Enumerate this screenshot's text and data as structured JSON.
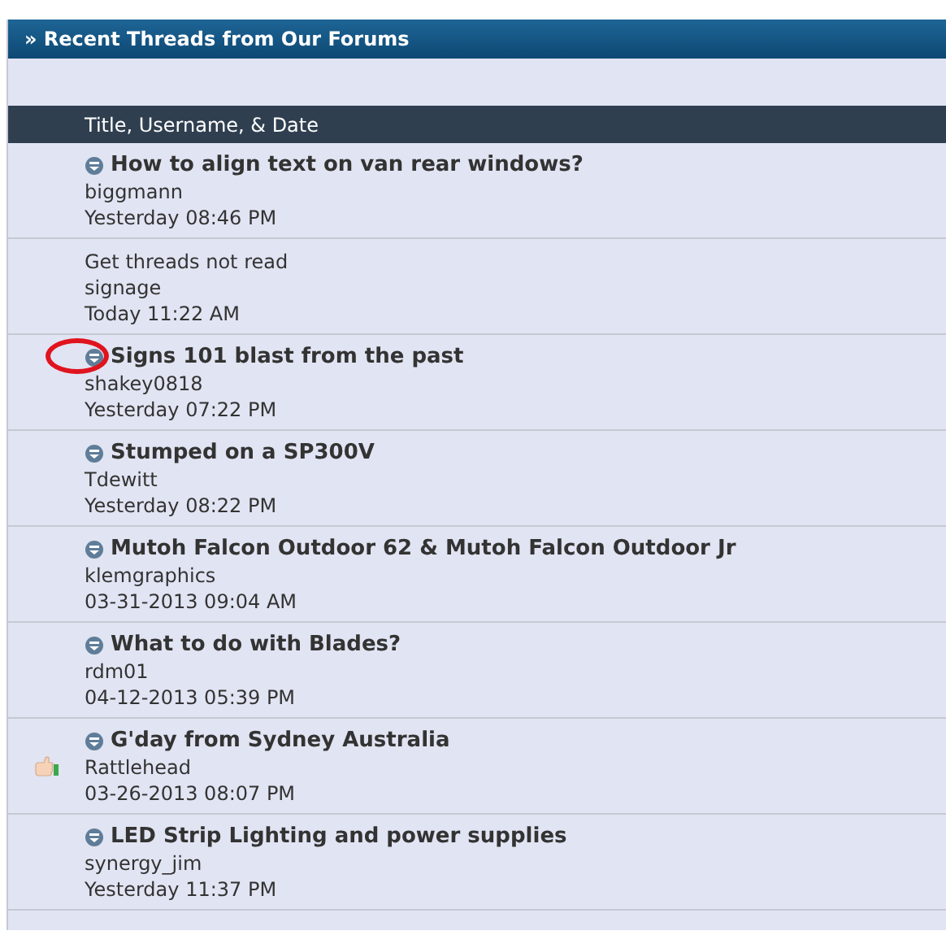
{
  "panel": {
    "title": "» Recent Threads from Our Forums"
  },
  "table": {
    "column_header": "Title, Username, & Date",
    "rows": [
      {
        "kind": "thread",
        "title": "How to align text on van rear windows?",
        "username": "biggmann",
        "date": "Yesterday 08:46 PM",
        "thumb_icon": false,
        "annotated": false
      },
      {
        "kind": "plain",
        "title": "Get threads not read",
        "username": "signage",
        "date": "Today 11:22 AM",
        "thumb_icon": false,
        "annotated": false
      },
      {
        "kind": "thread",
        "title": "Signs 101 blast from the past",
        "username": "shakey0818",
        "date": "Yesterday 07:22 PM",
        "thumb_icon": false,
        "annotated": true
      },
      {
        "kind": "thread",
        "title": "Stumped on a SP300V",
        "username": "Tdewitt",
        "date": "Yesterday 08:22 PM",
        "thumb_icon": false,
        "annotated": false
      },
      {
        "kind": "thread",
        "title": "Mutoh Falcon Outdoor 62 & Mutoh Falcon Outdoor Jr",
        "username": "klemgraphics",
        "date": "03-31-2013 09:04 AM",
        "thumb_icon": false,
        "annotated": false
      },
      {
        "kind": "thread",
        "title": "What to do with Blades?",
        "username": "rdm01",
        "date": "04-12-2013 05:39 PM",
        "thumb_icon": false,
        "annotated": false
      },
      {
        "kind": "thread",
        "title": "G'day from Sydney Australia",
        "username": "Rattlehead",
        "date": "03-26-2013 08:07 PM",
        "thumb_icon": true,
        "annotated": false
      },
      {
        "kind": "thread",
        "title": "LED Strip Lighting and power supplies",
        "username": "synergy_jim",
        "date": "Yesterday 11:37 PM",
        "thumb_icon": false,
        "annotated": false
      }
    ]
  }
}
